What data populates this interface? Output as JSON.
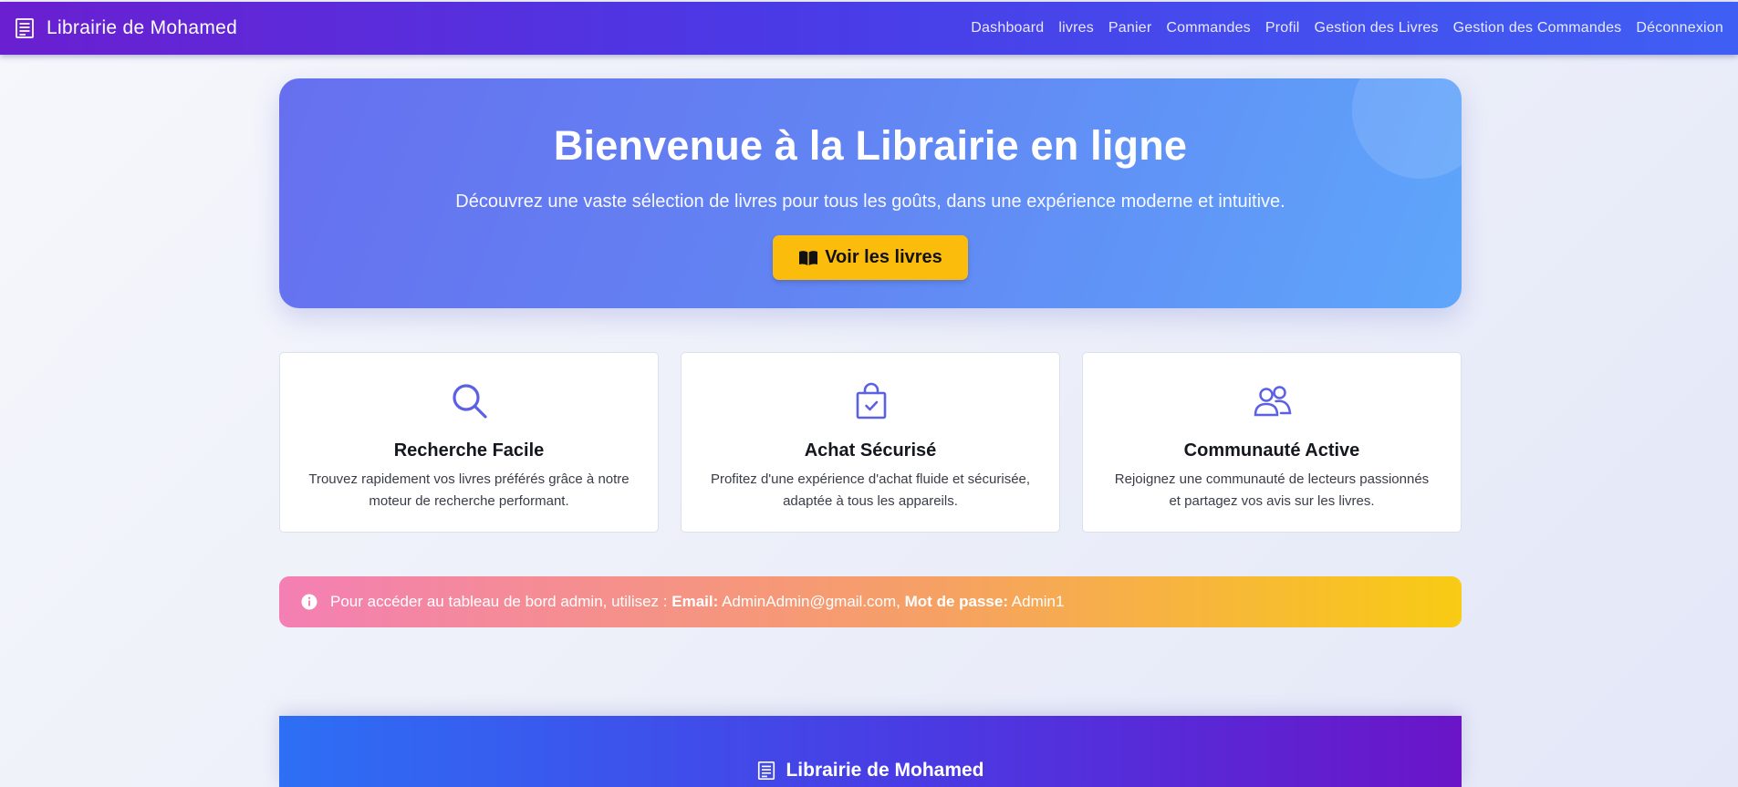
{
  "nav": {
    "brand": "Librairie de Mohamed",
    "brand_icon": "document-lines-icon",
    "links": [
      "Dashboard",
      "livres",
      "Panier",
      "Commandes",
      "Profil",
      "Gestion des Livres",
      "Gestion des Commandes",
      "Déconnexion"
    ]
  },
  "hero": {
    "title": "Bienvenue à la Librairie en ligne",
    "subtitle": "Découvrez une vaste sélection de livres pour tous les goûts, dans une expérience moderne et intuitive.",
    "cta_label": "Voir les livres",
    "cta_icon": "open-book-icon",
    "cta_color": "#fbbc0c"
  },
  "features": [
    {
      "icon": "search-icon",
      "title": "Recherche Facile",
      "line1": "Trouvez rapidement vos livres préférés grâce à notre",
      "line2": "moteur de recherche performant."
    },
    {
      "icon": "shopping-bag-check-icon",
      "title": "Achat Sécurisé",
      "line1": "Profitez d'une expérience d'achat fluide et sécurisée,",
      "line2": "adaptée à tous les appareils."
    },
    {
      "icon": "people-icon",
      "title": "Communauté Active",
      "line1": "Rejoignez une communauté de lecteurs passionnés",
      "line2": "et partagez vos avis sur les livres."
    }
  ],
  "alert": {
    "icon": "info-circle-icon",
    "prefix": "Pour accéder au tableau de bord admin, utilisez :",
    "email_label": "Email:",
    "email_value": "AdminAdmin@gmail.com,",
    "password_label": "Mot de passe:",
    "password_value": "Admin1"
  },
  "footer": {
    "brand": "Librairie de Mohamed",
    "brand_icon": "document-lines-icon"
  },
  "colors": {
    "accent": "#5a5ee8",
    "nav_start": "#6a1fd0",
    "nav_end": "#3f5ff4",
    "icon_color": "#5b61e4"
  }
}
